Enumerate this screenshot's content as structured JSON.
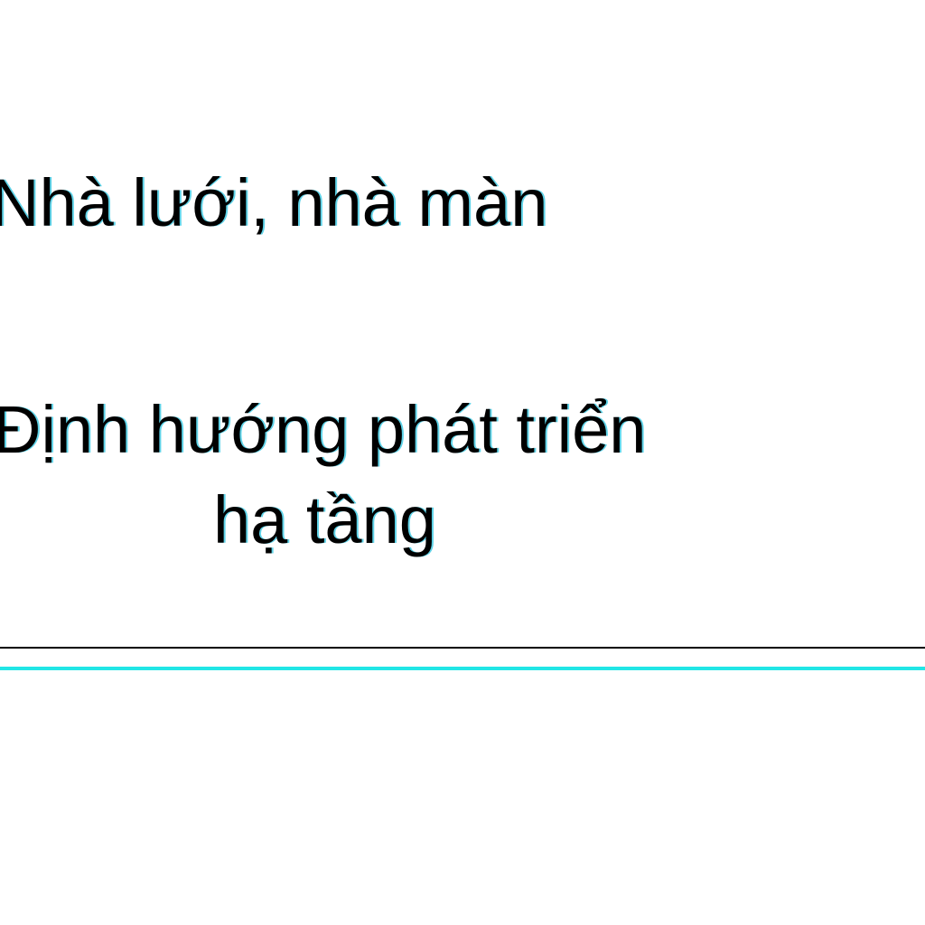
{
  "canvas": {
    "lines": [
      {
        "text": "Nhà lưới, nhà màn"
      },
      {
        "text": "Định hướng phát triển"
      },
      {
        "text": "hạ tầng"
      }
    ],
    "colors": {
      "text": "#000000",
      "text_fringe": "#5fd3e8",
      "rule_dark": "#000000",
      "rule_accent": "#22e6e6",
      "background": "#ffffff"
    }
  }
}
